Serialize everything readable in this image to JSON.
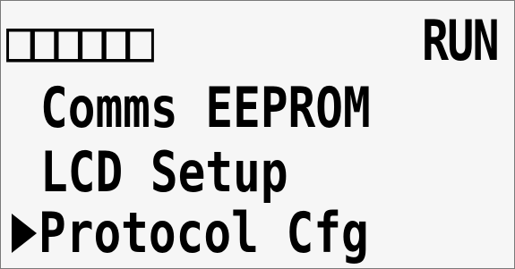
{
  "display": {
    "status_glyphs": "□□□□□□",
    "mode": "RUN",
    "cursor_icon": "selection-arrow-icon",
    "menu_items": [
      {
        "label": "Comms EEPROM",
        "selected": false
      },
      {
        "label": "LCD Setup",
        "selected": false
      },
      {
        "label": "Protocol Cfg",
        "selected": true
      }
    ]
  },
  "colors": {
    "background": "#f6f6f6",
    "text": "#000000",
    "border": "#7a7a7a"
  }
}
